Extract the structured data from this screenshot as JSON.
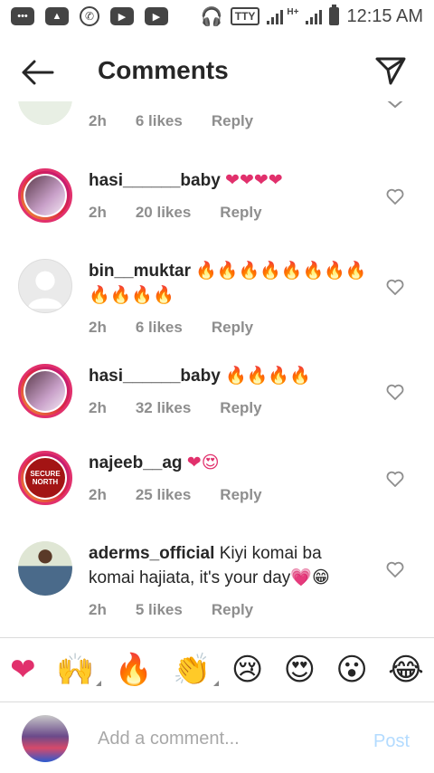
{
  "status_bar": {
    "tty": "TTY",
    "network": "H+",
    "time": "12:15 AM"
  },
  "header": {
    "title": "Comments",
    "back_icon": "arrow-left-icon",
    "send_icon": "paper-plane-icon"
  },
  "comments": [
    {
      "username": "",
      "text": "",
      "time": "2h",
      "likes": "6 likes",
      "reply": "Reply",
      "partial": true
    },
    {
      "username": "hasi______baby",
      "text": "❤❤❤❤",
      "time": "2h",
      "likes": "20 likes",
      "reply": "Reply"
    },
    {
      "username": "bin__muktar",
      "text": "🔥🔥🔥🔥🔥🔥🔥🔥🔥🔥🔥🔥",
      "time": "2h",
      "likes": "6 likes",
      "reply": "Reply"
    },
    {
      "username": "hasi______baby",
      "text": "🔥🔥🔥🔥",
      "time": "2h",
      "likes": "32 likes",
      "reply": "Reply"
    },
    {
      "username": "najeeb__ag",
      "text": "❤😍",
      "time": "2h",
      "likes": "25 likes",
      "reply": "Reply",
      "avatar_text": "SECURE NORTH"
    },
    {
      "username": "aderms_official",
      "text": "Kiyi komai ba komai hajiata, it's your day💗😁",
      "time": "2h",
      "likes": "5 likes",
      "reply": "Reply"
    }
  ],
  "emoji_bar": [
    "❤",
    "🙌",
    "🔥",
    "👏",
    "😢",
    "😍",
    "😮",
    "😂"
  ],
  "composer": {
    "placeholder": "Add a comment...",
    "post_label": "Post"
  },
  "colors": {
    "accent": "#e1306c",
    "muted": "#8e8e8e",
    "post_disabled": "#b3dbff"
  }
}
